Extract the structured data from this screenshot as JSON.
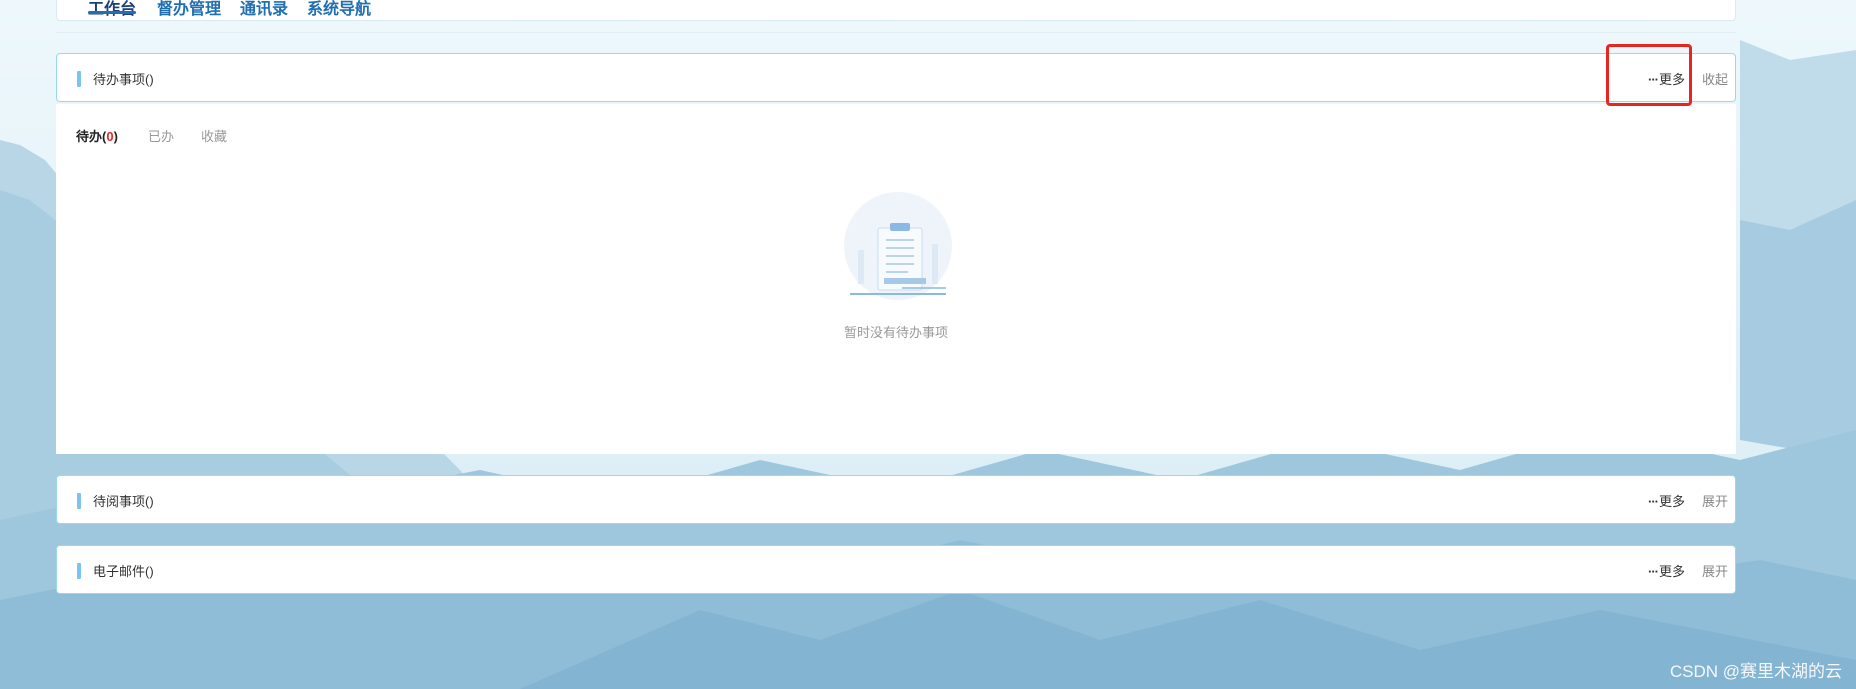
{
  "top_nav": {
    "tabs": [
      {
        "label": "工作台"
      },
      {
        "label": "督办管理"
      },
      {
        "label": "通讯录"
      },
      {
        "label": "系统导航"
      }
    ]
  },
  "todo_panel": {
    "title": "待办事项()",
    "more_label": "更多",
    "toggle_label": "收起",
    "subtabs": {
      "pending_label": "待办(",
      "pending_count": "0",
      "pending_close": ")",
      "done_label": "已办",
      "favorites_label": "收藏"
    },
    "empty_text": "暂时没有待办事项"
  },
  "toread_panel": {
    "title": "待阅事项()",
    "more_label": "更多",
    "toggle_label": "展开"
  },
  "email_panel": {
    "title": "电子邮件()",
    "more_label": "更多",
    "toggle_label": "展开"
  },
  "watermark": "CSDN @赛里木湖的云",
  "colors": {
    "accent": "#7cc3ee",
    "panel_border": "#9adbe3",
    "highlight": "#e8261f",
    "count_red": "#e8261f"
  }
}
